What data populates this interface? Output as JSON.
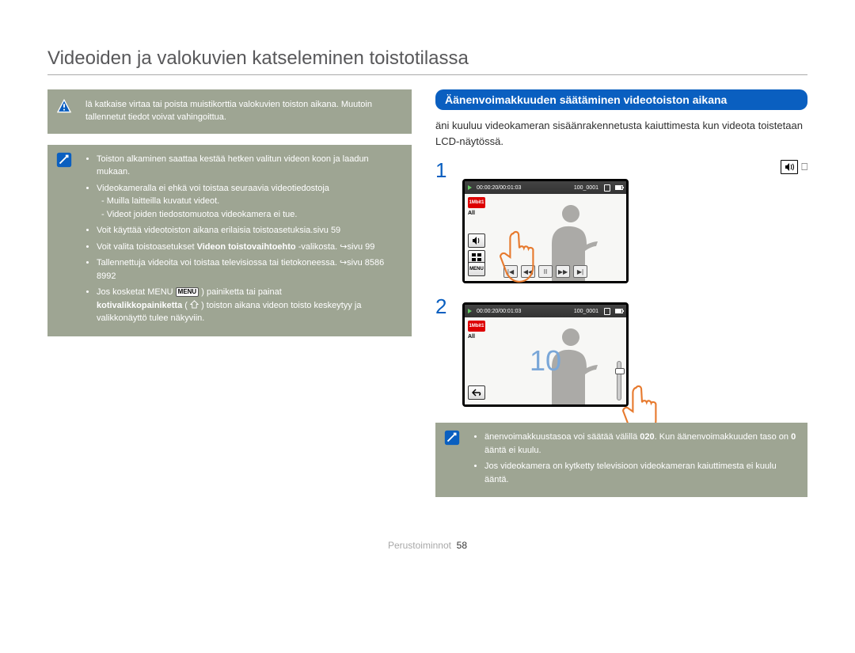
{
  "page": {
    "title": "Videoiden ja valokuvien katseleminen toistotilassa",
    "footer_label": "Perustoiminnot",
    "page_number": "58"
  },
  "warn": {
    "text": "lä katkaise virtaa tai poista muistikorttia valokuvien toiston aikana. Muutoin tallennetut tiedot voivat vahingoittua."
  },
  "info_left": {
    "items": [
      "Toiston alkaminen saattaa kestää hetken valitun videon koon ja laadun mukaan.",
      "Videokameralla ei ehkä voi toistaa seuraavia videotiedostoja",
      "Voit käyttää videotoiston aikana erilaisia toistoasetuksia.sivu 59",
      "Voit valita toistoasetukset Videon toistovaihtoehto -valikosta. ↪sivu 99",
      "Tallennettuja videoita voi toistaa televisiossa tai tietokoneessa. ↪sivu 8586 8992",
      "Jos kosketat MENU"
    ],
    "sub_items": [
      "- Muilla laitteilla kuvatut videot.",
      "- Videot joiden tiedostomuotoa videokamera ei tue."
    ],
    "bold_option": "Videon toistovaihtoehto",
    "menu_badge": "MENU",
    "menu_tail": ") painiketta tai painat",
    "home_line_a": "kotivalikkopainiketta",
    "home_line_b": "(     ) toiston aikana videon toisto keskeytyy ja valikkonäyttö tulee näkyviin."
  },
  "right": {
    "section_title": "Äänenvoimakkuuden säätäminen videotoiston aikana",
    "intro": "äni kuuluu videokameran sisäänrakennetusta kaiuttimesta kun videota toistetaan LCD-näytössä.",
    "step1": {
      "num": "1",
      "label": ""
    },
    "step2": {
      "num": "2",
      "label": "",
      "sub": " "
    },
    "lcd": {
      "time": "00:00:20/00:01:03",
      "clip": "100_0001",
      "badge": "1Mbit1",
      "all": "All",
      "menu": "MENU",
      "level": "10"
    }
  },
  "info_right": {
    "items": [
      "änenvoimakkuustasoa voi säätää välillä 020. Kun äänenvoimakkuuden taso on 0 ääntä ei kuulu.",
      "Jos videokamera on kytketty televisioon videokameran kaiuttimesta ei kuulu ääntä."
    ],
    "bold_range": "020",
    "bold_zero": "0"
  }
}
